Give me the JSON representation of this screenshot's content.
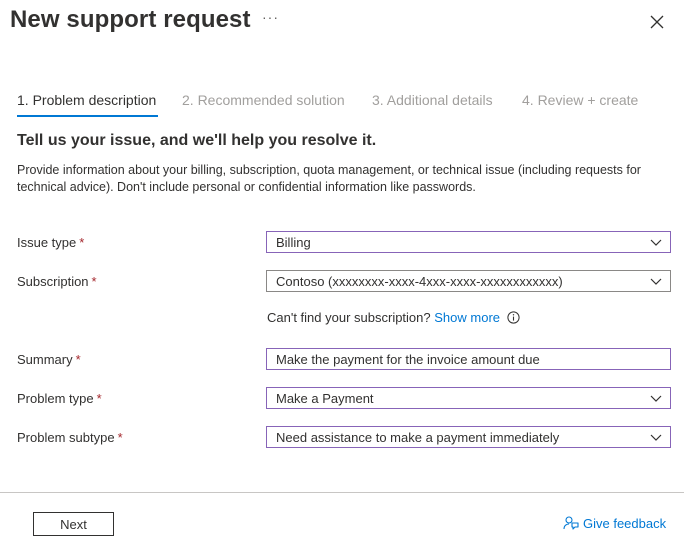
{
  "header": {
    "title": "New support request",
    "more_label": "···"
  },
  "tabs": [
    {
      "label": "1. Problem description",
      "active": true
    },
    {
      "label": "2. Recommended solution",
      "active": false
    },
    {
      "label": "3. Additional details",
      "active": false
    },
    {
      "label": "4. Review + create",
      "active": false
    }
  ],
  "section": {
    "heading": "Tell us your issue, and we'll help you resolve it.",
    "description": "Provide information about your billing, subscription, quota management, or technical issue (including requests for technical advice). Don't include personal or confidential information like passwords."
  },
  "form": {
    "required_marker": "*",
    "issue_type": {
      "label": "Issue type",
      "value": "Billing"
    },
    "subscription": {
      "label": "Subscription",
      "value": "Contoso (xxxxxxxx-xxxx-4xxx-xxxx-xxxxxxxxxxxx)"
    },
    "cant_find": {
      "text": "Can't find your subscription?",
      "link": "Show more"
    },
    "summary": {
      "label": "Summary",
      "value": "Make the payment for the invoice amount due"
    },
    "problem_type": {
      "label": "Problem type",
      "value": "Make a Payment"
    },
    "problem_subtype": {
      "label": "Problem subtype",
      "value": "Need assistance to make a payment immediately"
    }
  },
  "footer": {
    "next_label": "Next",
    "feedback_label": "Give feedback"
  },
  "colors": {
    "accent": "#0078d4",
    "focus_border": "#8764b8",
    "required": "#a4262c",
    "inactive_tab": "#a19f9d"
  },
  "icons": [
    "more-icon",
    "close-icon",
    "chevron-down-icon",
    "info-icon",
    "feedback-icon"
  ]
}
